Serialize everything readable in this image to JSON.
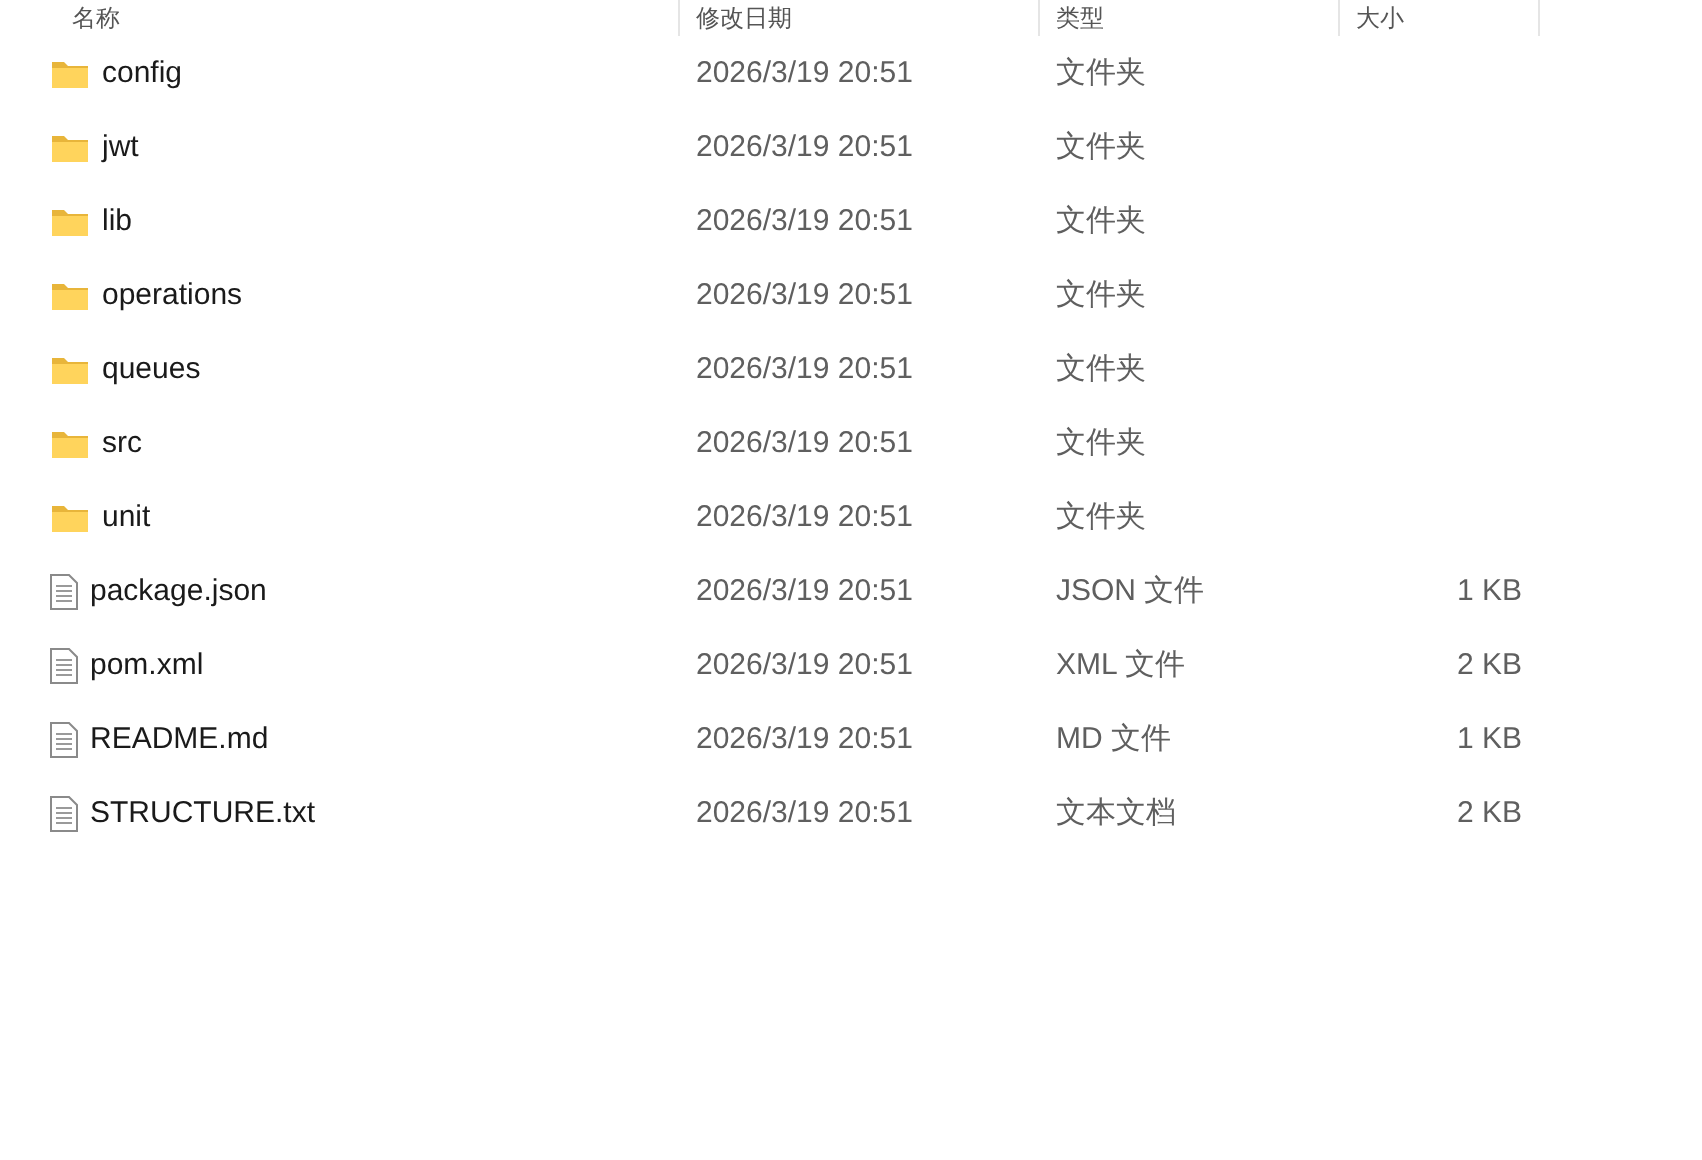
{
  "columns": [
    "名称",
    "修改日期",
    "类型",
    "大小"
  ],
  "files": [
    {
      "kind": "folder",
      "name": "config",
      "modified": "2026/3/19 20:51",
      "type": "文件夹"
    },
    {
      "kind": "folder",
      "name": "jwt",
      "modified": "2026/3/19 20:51",
      "type": "文件夹"
    },
    {
      "kind": "folder",
      "name": "lib",
      "modified": "2026/3/19 20:51",
      "type": "文件夹"
    },
    {
      "kind": "folder",
      "name": "operations",
      "modified": "2026/3/19 20:51",
      "type": "文件夹"
    },
    {
      "kind": "folder",
      "name": "queues",
      "modified": "2026/3/19 20:51",
      "type": "文件夹"
    },
    {
      "kind": "folder",
      "name": "src",
      "modified": "2026/3/19 20:51",
      "type": "文件夹"
    },
    {
      "kind": "folder",
      "name": "unit",
      "modified": "2026/3/19 20:51",
      "type": "文件夹"
    },
    {
      "kind": "file",
      "name": "package.json",
      "modified": "2026/3/19 20:51",
      "type": "JSON 文件",
      "size": "1 KB"
    },
    {
      "kind": "file",
      "name": "pom.xml",
      "modified": "2026/3/19 20:51",
      "type": "XML 文件",
      "size": "2 KB"
    },
    {
      "kind": "file",
      "name": "README.md",
      "modified": "2026/3/19 20:51",
      "type": "MD 文件",
      "size": "1 KB"
    },
    {
      "kind": "file",
      "name": "STRUCTURE.txt",
      "modified": "2026/3/19 20:51",
      "type": "文本文档",
      "size": "2 KB"
    }
  ]
}
